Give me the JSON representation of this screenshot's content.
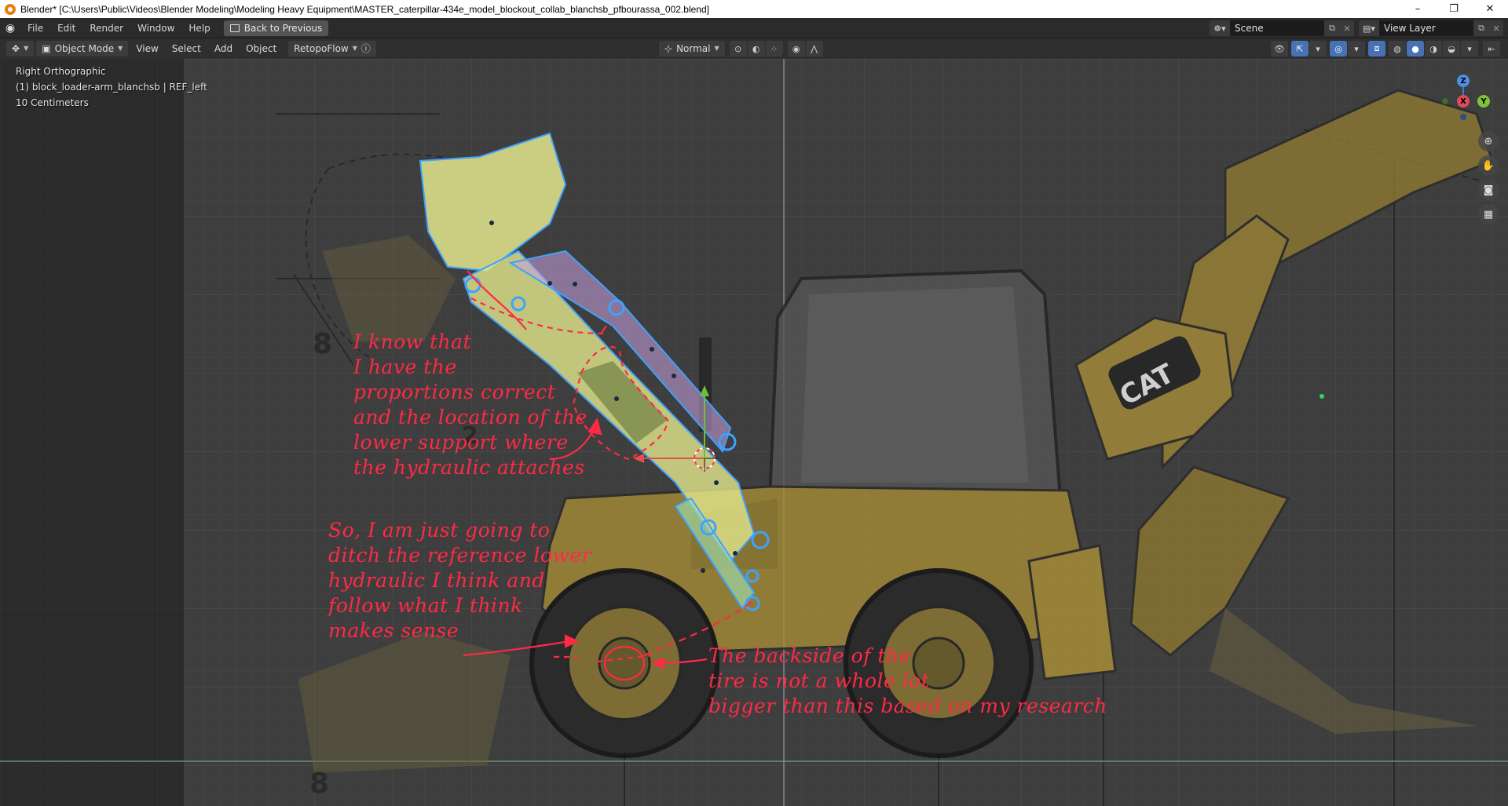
{
  "window": {
    "title": "Blender* [C:\\Users\\Public\\Videos\\Blender Modeling\\Modeling Heavy Equipment\\MASTER_caterpillar-434e_model_blockout_collab_blanchsb_pfbourassa_002.blend]",
    "controls": [
      "–",
      "❐",
      "✕"
    ]
  },
  "menubar": {
    "items": [
      "File",
      "Edit",
      "Render",
      "Window",
      "Help"
    ],
    "back_button": "Back to Previous",
    "scene_label": "Scene",
    "view_layer_label": "View Layer"
  },
  "view_header": {
    "editor_type": "✥",
    "mode": "Object Mode",
    "menus": [
      "View",
      "Select",
      "Add",
      "Object"
    ],
    "addon": "RetopoFlow",
    "transform_orientation": "Normal"
  },
  "viewport_info": {
    "view_name": "Right Orthographic",
    "active_object": "(1) block_loader-arm_blanchsb | REF_left",
    "scale": "10 Centimeters"
  },
  "annotations": {
    "note1": [
      "I know that",
      "I have the",
      "proportions correct",
      "and the location of the",
      "lower support where",
      "the hydraulic attaches"
    ],
    "note2": [
      "So, I am just going to",
      "ditch the reference lower",
      "hydraulic I think and",
      "follow what I think",
      "makes sense"
    ],
    "note3": [
      "The backside of the",
      "tire is not a whole lot",
      "bigger than this based on my research"
    ]
  },
  "drawing_labels": {
    "ref_number_8_top": "8",
    "ref_number_8_bottom": "8",
    "ref_number_2": "2",
    "brand_text": "CAT"
  },
  "colors": {
    "accent": "#4772b3",
    "annotation": "#ff2a45",
    "machine": "#c9a22c",
    "selection": "#e0f090"
  },
  "gizmo": {
    "z": "Z",
    "y": "Y",
    "x": "X"
  }
}
